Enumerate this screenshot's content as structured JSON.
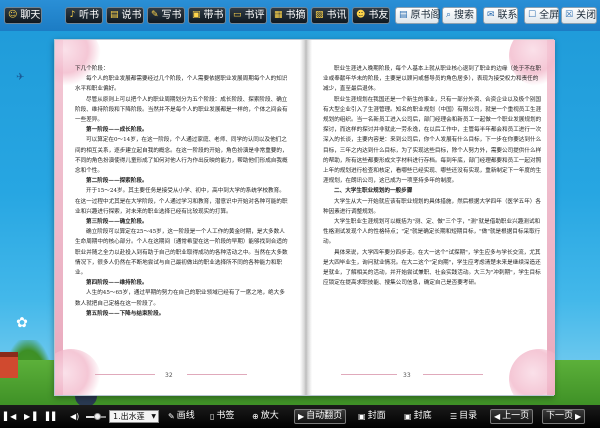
{
  "toolbar": {
    "left_buttons": [
      {
        "label": "聊天",
        "icon": "smile-icon",
        "glyph": "☺"
      },
      {
        "label": "听书",
        "icon": "headphones-icon",
        "glyph": "♪"
      },
      {
        "label": "说书",
        "icon": "book-icon",
        "glyph": "▤"
      },
      {
        "label": "写书",
        "icon": "pencil-icon",
        "glyph": "✎"
      },
      {
        "label": "带书",
        "icon": "bag-icon",
        "glyph": "▣"
      },
      {
        "label": "书评",
        "icon": "comment-icon",
        "glyph": "▭"
      },
      {
        "label": "书摘",
        "icon": "note-icon",
        "glyph": "▦"
      },
      {
        "label": "书讯",
        "icon": "news-icon",
        "glyph": "▧"
      },
      {
        "label": "书友",
        "icon": "friends-icon",
        "glyph": "☻"
      }
    ],
    "right_buttons": [
      {
        "label": "原书阁",
        "icon": "book-stack-icon",
        "glyph": ""
      },
      {
        "label": "搜索",
        "icon": "search-icon",
        "glyph": "⌕"
      },
      {
        "label": "联系",
        "icon": "mail-icon",
        "glyph": "✉"
      },
      {
        "label": "全屏",
        "icon": "fullscreen-icon",
        "glyph": "☐"
      },
      {
        "label": "关闭",
        "icon": "close-icon",
        "glyph": "☒"
      }
    ]
  },
  "book": {
    "left_page": {
      "number": "32",
      "paragraphs": [
        {
          "text": "下几个阶段：",
          "style": "noind"
        },
        {
          "text": "每个人的职业发展都需要经过几个阶段，个人需要依据职业发展周期每个人的知识水平和职业偏好。",
          "style": ""
        },
        {
          "text": "尽管从原则上可以把个人的职业周期划分为五个阶段：成长阶段、探索阶段、确立阶段、维持阶段和下降阶段。当然并不是每个人的职业发展都是一样的，个体之间会有一些差异。",
          "style": ""
        },
        {
          "text": "第一阶段——成长阶段。",
          "style": "heading"
        },
        {
          "text": "可以算定在0～14岁，在这一阶段，个人通过家庭、老师、同学的认同以及他们之间的相互关系，逐步建立起自我的概念。在这一阶段的开始，角色扮演是非常重要的，不同的角色扮演使得儿童形成了如何对他人行为作出反映的能力，帮助他们形成自我概念和个性。",
          "style": ""
        },
        {
          "text": "第二阶段——探索阶段。",
          "style": "heading"
        },
        {
          "text": "开于15～24岁。其主要任务是接受从小学、初中，高中到大学的系统学校教育。在这一过程中尤其是在大学阶段，个人通过学习和教育，潜意识中开始对各种可能的职业和兴趣进行探索，对未来的职业选择已经有比较现实的打算。",
          "style": ""
        },
        {
          "text": "第三阶段——确立阶段。",
          "style": "heading"
        },
        {
          "text": "确立阶段可以算定在25～45岁，这一阶段是一个人工作的黄金时期，是大多数人生命周期中的核心部分。个人在这期间（通常希望在这一阶段的早期）能够找到合适的职业并随之全力以赴投入到有助于自己的职业取得成功的各种活动之中。当然在大多数情况下，很多人仍然在不断地尝试与自己最初做出的职业选择所不同的各种能力和职业。",
          "style": ""
        },
        {
          "text": "第四阶段——维持阶段。",
          "style": "heading"
        },
        {
          "text": "人生的45～65岁，通过早期的努力在自己的职业领域已经有了一席之地，绝大多数人就把自己定格在这一阶段了。",
          "style": ""
        },
        {
          "text": "第五阶段——下降与结束阶段。",
          "style": "heading"
        }
      ]
    },
    "right_page": {
      "number": "33",
      "paragraphs": [
        {
          "text": "职业生涯进入晚期阶段，每个人基本上就从职业核心退到了职业的边缘（处于不在职业或奉献年华未的阶段，主要是以顾问或督导员的角色居多），表现为接受权力和责任的减少，直至最后退休。",
          "style": ""
        },
        {
          "text": "职业生涯规划在我国还是一个新生的事业，只有一部分外资、合资企业以及极个别国有大型企业引入了生涯管理。知名的职业规划（中国）有限公司，就是一个重视员工生涯规划的组织。当一名新员工进入公司后，部门经理会和新员工一起做一个职业发展规划的探讨，而这样的探讨并非就此一劳永逸，在以后工作中，主管每半年都会和员工进行一次深入的长谈，主要内容是：来到公司后，你个人发展有什么目标，下一步在你要达到什么目标，三年之内达到什么目标，为了实现这些目标，除个人努力外，需要公司提供什么样的帮助，所有这些都要形成文字材料进行存档。每到年底，部门经理都要和员工一起对照上年的规划进行检查和核定，看哪些已经实现、哪些还没有实现，重新制定下一年度的生涯规划，在朗讯公司，这已成为一项坚持多年的制度。",
          "style": ""
        },
        {
          "text": "二、大学生职业规划的一般步骤",
          "style": "heading"
        },
        {
          "text": "大学生从大一开始就应该有职业规划的具体措施，然后根据大学四年（医学五年）各种因素进行调整规划。",
          "style": ""
        },
        {
          "text": "大学生职业生涯规划可以概括为\"测、定、做\"三个字，\"测\"就是借助职业兴趣测试和性格测试发现个人的性格特点；\"定\"就是确定长期和短期目标，\"做\"就是根据目标采取行动。",
          "style": ""
        },
        {
          "text": "具体来说，大学四年要分四步走。在大一这个\"试探期\"，学生应多与学长交流，尤其是大四毕业生，询问就业情况。在大二这个\"定向期\"，学生应考虑清楚未来是继续深造还是就业，了解相关的活动，并开始尝试兼职、社会实践活动。大三为\"冲刺期\"，学生目标应锁定在提高求职技能、搜集公司信息，确定自己是否要考研。",
          "style": ""
        }
      ]
    }
  },
  "bottombar": {
    "playback_glyphs": [
      "▌◀",
      "▶▐",
      "▌▌"
    ],
    "volume_level": 0.55,
    "mode_select": "1.出水莲",
    "items": [
      {
        "label": "画线",
        "icon": "pen-icon",
        "glyph": "✎"
      },
      {
        "label": "书签",
        "icon": "bookmark-icon",
        "glyph": "▯"
      },
      {
        "label": "放大",
        "icon": "zoom-in-icon",
        "glyph": "⊕"
      },
      {
        "label": "自动翻页",
        "icon": "auto-turn-icon",
        "glyph": "▶"
      },
      {
        "label": "封面",
        "icon": "cover-icon",
        "glyph": "▣"
      },
      {
        "label": "封底",
        "icon": "back-cover-icon",
        "glyph": "▣"
      },
      {
        "label": "目录",
        "icon": "contents-icon",
        "glyph": "☰"
      },
      {
        "label": "上一页",
        "icon": "prev-page-icon",
        "glyph": "◀"
      },
      {
        "label": "下一页",
        "icon": "next-page-icon",
        "glyph": "▶"
      }
    ]
  }
}
